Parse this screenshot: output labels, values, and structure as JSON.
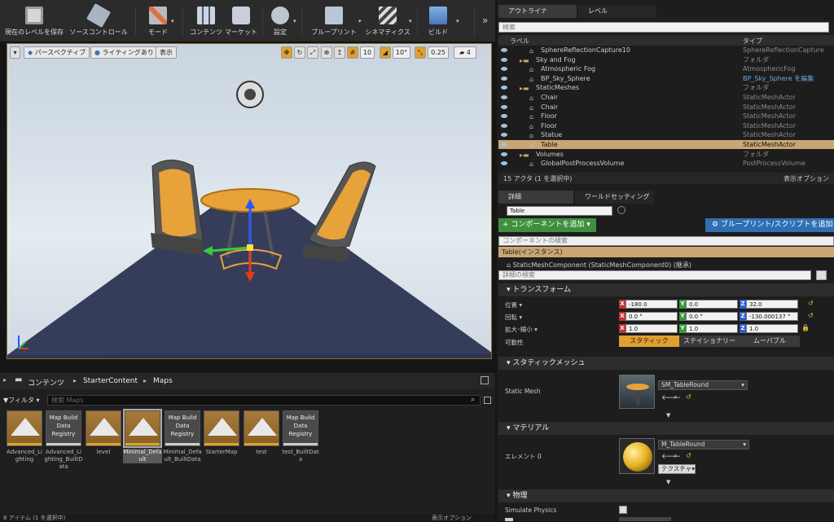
{
  "toolbar": {
    "save": "現在のレベルを保存",
    "source_control": "ソースコントロール",
    "modes": "モード",
    "content": "コンテンツ",
    "market": "マーケット",
    "settings": "設定",
    "blueprints": "ブループリント",
    "cinematics": "シネマティクス",
    "build": "ビルド"
  },
  "viewport": {
    "perspective": "パースペクティブ",
    "lighting": "ライティングあり",
    "show": "表示",
    "grid_value": "10",
    "angle_value": "10°",
    "scale_value": "0.25",
    "cam_speed": "4"
  },
  "content_browser": {
    "tab": "コンテンツ",
    "path": [
      "StarterContent",
      "Maps"
    ],
    "filter": "フィルタ",
    "search_placeholder": "検索 Maps",
    "status": "8 アイテム (1 を選択中)",
    "view_options": "表示オプション",
    "items": [
      {
        "name": "Advanced_Lighting",
        "kind": "map"
      },
      {
        "name": "Advanced_Lighting_BuiltData",
        "kind": "registry"
      },
      {
        "name": "level",
        "kind": "map"
      },
      {
        "name": "Minimal_Default",
        "kind": "map"
      },
      {
        "name": "Minimal_Default_BuiltData",
        "kind": "registry"
      },
      {
        "name": "StarterMap",
        "kind": "map"
      },
      {
        "name": "test",
        "kind": "map"
      },
      {
        "name": "test_BuiltData",
        "kind": "registry"
      }
    ],
    "registry_label": "Map Build Data Registry"
  },
  "outliner": {
    "tab": "アウトライナ",
    "tab2": "レベル",
    "search_placeholder": "検索",
    "col_label": "ラベル",
    "col_type": "タイプ",
    "rows": [
      {
        "name": "SphereReflectionCapture10",
        "type": "SphereReflectionCapture",
        "indent": 2
      },
      {
        "name": "Sky and Fog",
        "type": "フォルダ",
        "indent": 1
      },
      {
        "name": "Atmospheric Fog",
        "type": "AtmosphericFog",
        "indent": 2
      },
      {
        "name": "BP_Sky_Sphere",
        "type": "BP_Sky_Sphere を編集",
        "indent": 2
      },
      {
        "name": "StaticMeshes",
        "type": "フォルダ",
        "indent": 1
      },
      {
        "name": "Chair",
        "type": "StaticMeshActor",
        "indent": 2
      },
      {
        "name": "Chair",
        "type": "StaticMeshActor",
        "indent": 2
      },
      {
        "name": "Floor",
        "type": "StaticMeshActor",
        "indent": 2
      },
      {
        "name": "Floor",
        "type": "StaticMeshActor",
        "indent": 2
      },
      {
        "name": "Statue",
        "type": "StaticMeshActor",
        "indent": 2
      },
      {
        "name": "Table",
        "type": "StaticMeshActor",
        "indent": 2,
        "selected": true
      },
      {
        "name": "Volumes",
        "type": "フォルダ",
        "indent": 1
      },
      {
        "name": "GlobalPostProcessVolume",
        "type": "PostProcessVolume",
        "indent": 2
      }
    ],
    "status": "15 アクタ (1 を選択中)",
    "view_options": "表示オプション"
  },
  "details": {
    "tab": "詳細",
    "tab2": "ワールドセッティング",
    "name": "Table",
    "add_component": "+ コンポーネントを追加 ▾",
    "blueprint_script": "ブループリント/スクリプトを追加",
    "component_search": "コンポーネントの検索",
    "instance": "Table(インスタンス)",
    "component": "StaticMeshComponent (StaticMeshComponent0) (継承)",
    "detail_search": "詳細の検索",
    "transform": {
      "title": "トランスフォーム",
      "location_label": "位置 ▾",
      "rotation_label": "回転 ▾",
      "scale_label": "拡大･縮小 ▾",
      "mobility_label": "可動性",
      "location": [
        "-180.0",
        "0.0",
        "32.0"
      ],
      "rotation": [
        "0.0 °",
        "0.0 °",
        "-130.000137 °"
      ],
      "scale": [
        "1.0",
        "1.0",
        "1.0"
      ],
      "mobility": [
        "スタティック",
        "ステイショナリー",
        "ムーバブル"
      ]
    },
    "static_mesh": {
      "title": "スタティックメッシュ",
      "label": "Static Mesh",
      "value": "SM_TableRound"
    },
    "materials": {
      "title": "マテリアル",
      "label": "エレメント 0",
      "value": "M_TableRound",
      "texture_btn": "テクスチャ▾"
    },
    "physics": {
      "title": "物理",
      "simulate": "Simulate Physics"
    }
  },
  "colors": {
    "accent": "#e0a030",
    "selected": "#c9a673",
    "add_green": "#3f8f3f",
    "bp_blue": "#2f6fb3"
  }
}
